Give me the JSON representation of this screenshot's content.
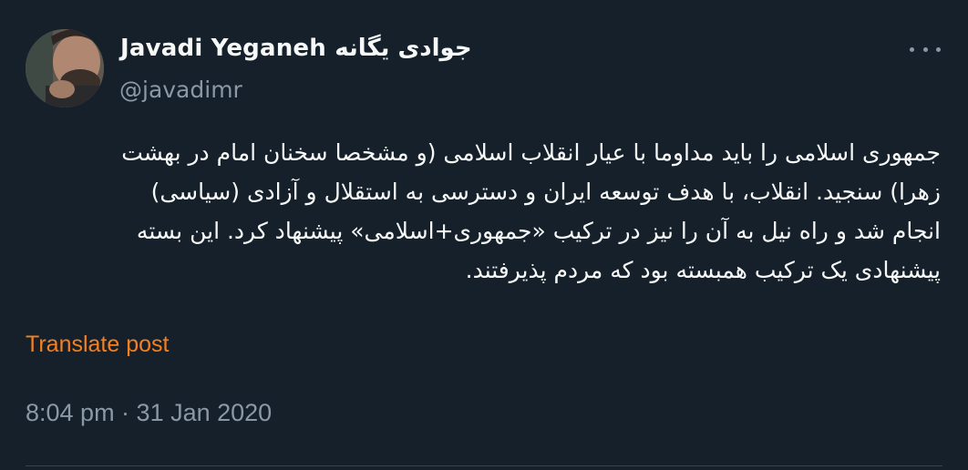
{
  "author": {
    "display_name": "Javadi Yeganeh جوادی یگانه",
    "handle": "@javadimr"
  },
  "more_icon": "more-horizontal-icon",
  "body": "جمهوری اسلامی را باید مداوما با عیار انقلاب اسلامی (و مشخصا سخنان امام در بهشت\nزهرا) سنجید. انقلاب، با هدف توسعه ایران و دسترسی به استقلال و آزادی (سیاسی)\nانجام شد و راه نیل به آن را نیز در ترکیب «جمهوری+اسلامی» پیشنهاد کرد. این بسته\nپیشنهادی یک ترکیب همبسته بود که مردم پذیرفتند.",
  "translate_label": "Translate post",
  "timestamp": "8:04 pm · 31 Jan 2020",
  "colors": {
    "background": "#15202b",
    "text": "#f7f9f9",
    "secondary": "#8b98a5",
    "accent": "#f4801f"
  }
}
